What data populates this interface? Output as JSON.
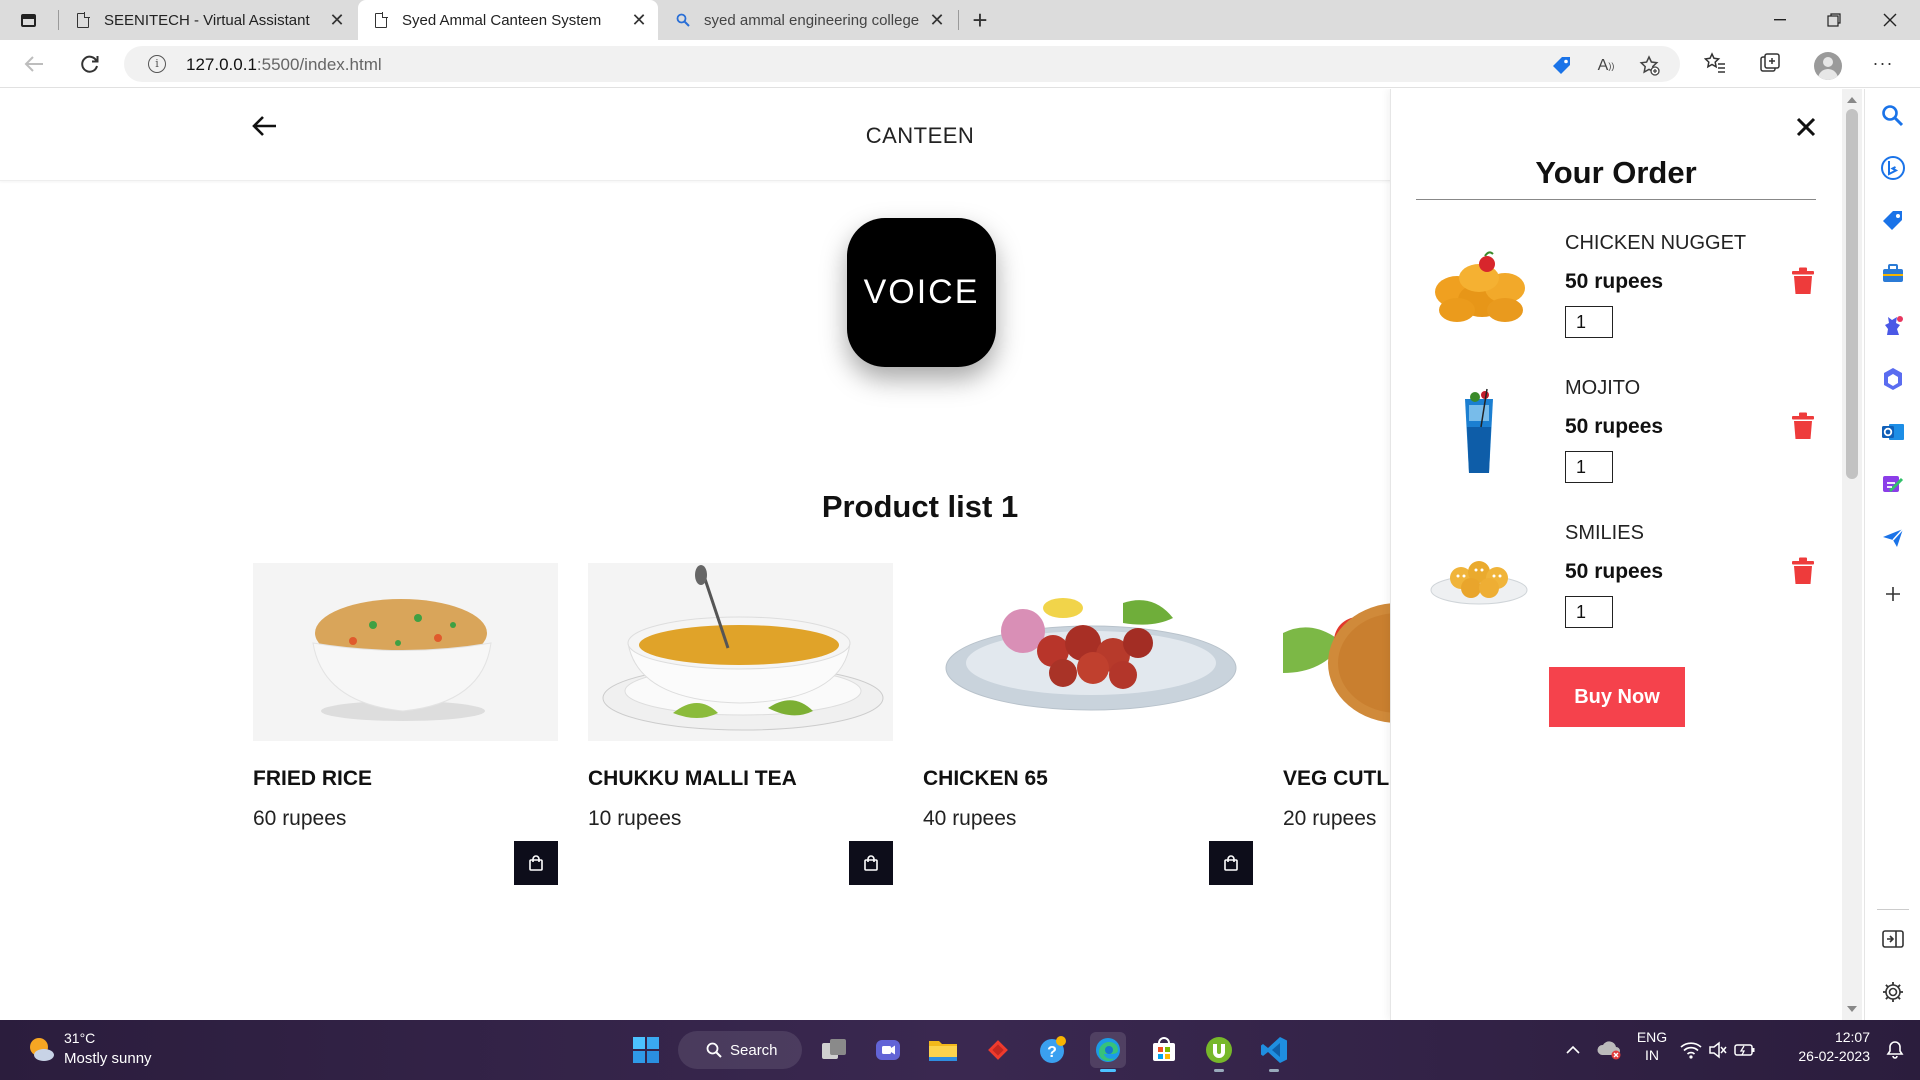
{
  "browser": {
    "tabs": [
      {
        "title": "SEENITECH - Virtual Assistant",
        "icon": "page-icon",
        "active": false
      },
      {
        "title": "Syed Ammal Canteen System",
        "icon": "page-icon",
        "active": true
      },
      {
        "title": "syed ammal engineering college",
        "icon": "search-icon",
        "active": false
      }
    ],
    "url_host": "127.0.0.1",
    "url_path": ":5500/index.html"
  },
  "page": {
    "title": "CANTEEN",
    "voice_button_label": "VOICE",
    "section_title": "Product list 1",
    "products": [
      {
        "name": "FRIED RICE",
        "price": "60 rupees",
        "image": "fried-rice"
      },
      {
        "name": "CHUKKU MALLI TEA",
        "price": "10 rupees",
        "image": "tea-cup"
      },
      {
        "name": "CHICKEN 65",
        "price": "40 rupees",
        "image": "chicken-65"
      },
      {
        "name": "VEG CUTLET",
        "price": "20 rupees",
        "image": "veg-cutlet"
      }
    ]
  },
  "order": {
    "title": "Your Order",
    "items": [
      {
        "name": "CHICKEN NUGGET",
        "price": "50 rupees",
        "quantity": "1"
      },
      {
        "name": "MOJITO",
        "price": "50 rupees",
        "quantity": "1"
      },
      {
        "name": "SMILIES",
        "price": "50 rupees",
        "quantity": "1"
      }
    ],
    "buy_label": "Buy Now"
  },
  "colors": {
    "buy_button": "#f5424c",
    "trash": "#ee3b3b",
    "voice_button": "#000000",
    "cart_button": "#0d0d1a"
  },
  "taskbar": {
    "temperature": "31°C",
    "weather": "Mostly sunny",
    "search_label": "Search",
    "language_top": "ENG",
    "language_bottom": "IN",
    "time": "12:07",
    "date": "26-02-2023"
  }
}
